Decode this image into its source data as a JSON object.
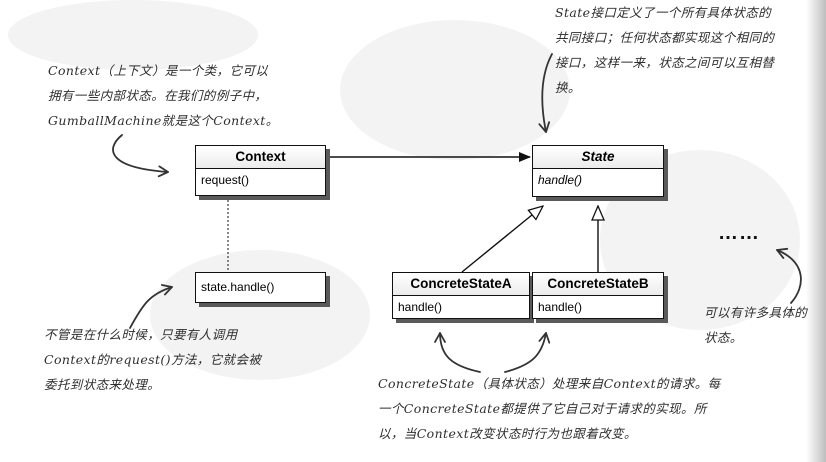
{
  "notes": {
    "context": [
      "Context（上下文）是一个类，它可以",
      "拥有一些内部状态。在我们的例子中，",
      "GumballMachine就是这个Context。"
    ],
    "state": [
      "State接口定义了一个所有具体状态的",
      "共同接口；任何状态都实现这个相同的",
      "接口，这样一来，状态之间可以互相替",
      "换。"
    ],
    "request": [
      "不管是在什么时候，只要有人调用",
      "Context的request()方法，它就会被",
      "委托到状态来处理。"
    ],
    "many": [
      "可以有许多具体的",
      "状态。"
    ],
    "concrete": [
      "ConcreteState（具体状态）处理来自Context的请求。每",
      "一个ConcreteState都提供了它自己对于请求的实现。所",
      "以，当Context改变状态时行为也跟着改变。"
    ]
  },
  "classes": {
    "context": {
      "name": "Context",
      "operation": "request()"
    },
    "state": {
      "name": "State",
      "operation": "handle()"
    },
    "concrete_a": {
      "name": "ConcreteStateA",
      "operation": "handle()"
    },
    "concrete_b": {
      "name": "ConcreteStateB",
      "operation": "handle()"
    }
  },
  "handle_call": "state.handle()",
  "ellipsis": "……"
}
